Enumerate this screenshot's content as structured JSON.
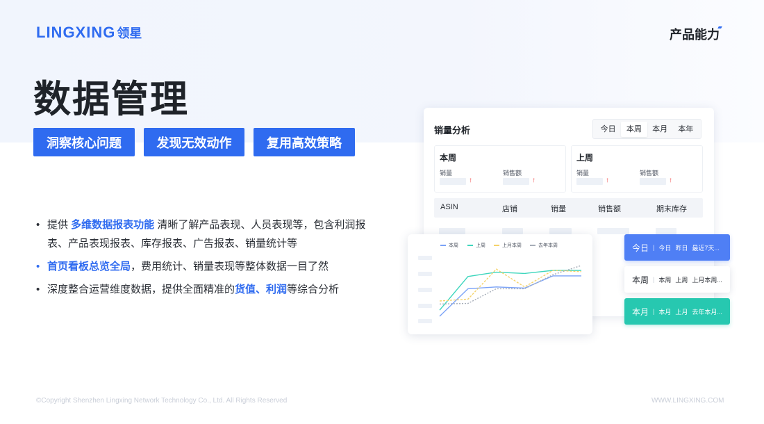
{
  "brand": {
    "logo_en": "LINGXING",
    "logo_cn": "领星"
  },
  "section_title": "产品能力",
  "page_title": "数据管理",
  "tags": [
    "洞察核心问题",
    "发现无效动作",
    "复用高效策略"
  ],
  "bullets": [
    {
      "prefix": "提供 ",
      "highlight": "多维数据报表功能",
      "suffix": " 清晰了解产品表现、人员表现等，包含利润报表、产品表现报表、库存报表、广告报表、销量统计等"
    },
    {
      "prefix": "",
      "highlight": "首页看板总览全局",
      "suffix": "，费用统计、销量表现等整体数据一目了然"
    },
    {
      "prefix": "深度整合运营维度数据，提供全面精准的",
      "highlight": "货值、利润",
      "suffix": "等综合分析"
    }
  ],
  "dashboard": {
    "title": "销量分析",
    "range_tabs": [
      "今日",
      "本周",
      "本月",
      "本年"
    ],
    "selected_tab": "本周",
    "periods": [
      {
        "name": "本周",
        "metric_1": "销量",
        "metric_2": "销售额"
      },
      {
        "name": "上周",
        "metric_1": "销量",
        "metric_2": "销售额"
      }
    ],
    "table_headers": [
      "ASIN",
      "店铺",
      "销量",
      "销售额",
      "期末库存"
    ],
    "up_arrow": "↑"
  },
  "chart": {
    "legend": [
      "本周",
      "上周",
      "上月本周",
      "去年本周"
    ],
    "colors": {
      "本周": "#7aa2f7",
      "上周": "#3ed6bd",
      "上月本周": "#f5d36b",
      "去年本周": "#a6adb8"
    }
  },
  "chart_data": {
    "type": "line",
    "series": [
      {
        "name": "本周",
        "values": [
          0,
          45,
          48,
          46,
          66,
          66
        ]
      },
      {
        "name": "上周",
        "values": [
          10,
          65,
          72,
          70,
          75,
          75
        ]
      },
      {
        "name": "上月本周",
        "values": [
          25,
          28,
          77,
          48,
          75,
          73
        ]
      },
      {
        "name": "去年本周",
        "values": [
          20,
          21,
          45,
          45,
          68,
          83
        ]
      }
    ],
    "ylim": [
      0,
      100
    ]
  },
  "pills": [
    {
      "main": "今日",
      "sep": "|",
      "options": [
        "今日",
        "昨日",
        "最近7天..."
      ]
    },
    {
      "main": "本周",
      "sep": "|",
      "options": [
        "本周",
        "上周",
        "上月本周..."
      ]
    },
    {
      "main": "本月",
      "sep": "|",
      "options": [
        "本月",
        "上月",
        "去年本月..."
      ]
    }
  ],
  "footer": {
    "copyright": "©Copyright Shenzhen Lingxing Network Technology Co., Ltd. All Rights Reserved",
    "website": "WWW.LINGXING.COM"
  }
}
